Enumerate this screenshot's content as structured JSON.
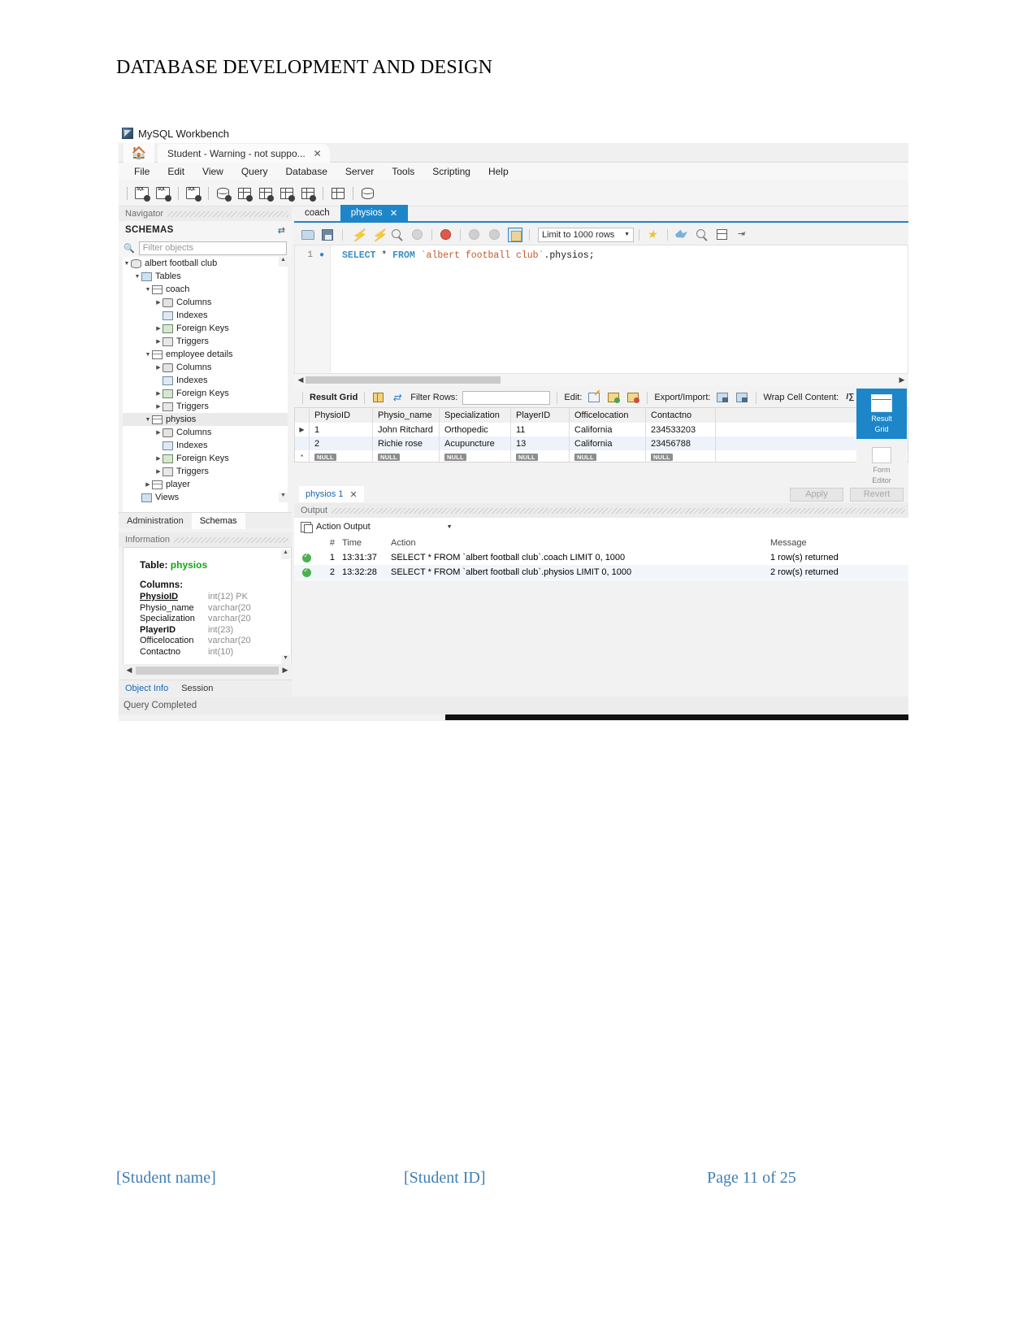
{
  "document": {
    "title": "DATABASE DEVELOPMENT AND DESIGN",
    "footer": {
      "student_name": "[Student name]",
      "student_id": "[Student ID]",
      "page": "Page 11 of 25"
    }
  },
  "app": {
    "title": "MySQL Workbench",
    "icon": "mysql-workbench-icon"
  },
  "tabstrip": {
    "home_icon": "home-icon",
    "doc_tab_label": "Student - Warning - not suppo...",
    "close_icon": "close-icon"
  },
  "menubar": {
    "items": [
      {
        "label": "File"
      },
      {
        "label": "Edit"
      },
      {
        "label": "View"
      },
      {
        "label": "Query"
      },
      {
        "label": "Database"
      },
      {
        "label": "Server"
      },
      {
        "label": "Tools"
      },
      {
        "label": "Scripting"
      },
      {
        "label": "Help"
      }
    ]
  },
  "main_toolbar": {
    "icons": [
      "new-sql-tab-icon",
      "open-sql-script-icon",
      "connect-to-database-icon",
      "new-schema-icon",
      "new-table-icon",
      "new-view-icon",
      "new-procedure-icon",
      "new-function-icon",
      "search-data-icon",
      "reconnect-dbms-icon"
    ]
  },
  "navigator": {
    "panel_label": "Navigator",
    "section_label": "SCHEMAS",
    "refresh_icon": "refresh-icon",
    "search_icon": "search-icon",
    "filter": {
      "placeholder": "Filter objects",
      "value": ""
    },
    "tree": [
      {
        "label": "albert football club",
        "depth": 0,
        "arrow": "down",
        "icon": "database-icon",
        "selected": false
      },
      {
        "label": "Tables",
        "depth": 1,
        "arrow": "down",
        "icon": "folder-icon",
        "selected": false
      },
      {
        "label": "coach",
        "depth": 2,
        "arrow": "down",
        "icon": "table-icon",
        "selected": false
      },
      {
        "label": "Columns",
        "depth": 3,
        "arrow": "right",
        "icon": "columns-icon",
        "selected": false
      },
      {
        "label": "Indexes",
        "depth": 3,
        "arrow": "none",
        "icon": "indexes-icon",
        "selected": false
      },
      {
        "label": "Foreign Keys",
        "depth": 3,
        "arrow": "right",
        "icon": "foreign-keys-icon",
        "selected": false
      },
      {
        "label": "Triggers",
        "depth": 3,
        "arrow": "right",
        "icon": "triggers-icon",
        "selected": false
      },
      {
        "label": "employee details",
        "depth": 2,
        "arrow": "down",
        "icon": "table-icon",
        "selected": false
      },
      {
        "label": "Columns",
        "depth": 3,
        "arrow": "right",
        "icon": "columns-icon",
        "selected": false
      },
      {
        "label": "Indexes",
        "depth": 3,
        "arrow": "none",
        "icon": "indexes-icon",
        "selected": false
      },
      {
        "label": "Foreign Keys",
        "depth": 3,
        "arrow": "right",
        "icon": "foreign-keys-icon",
        "selected": false
      },
      {
        "label": "Triggers",
        "depth": 3,
        "arrow": "right",
        "icon": "triggers-icon",
        "selected": false
      },
      {
        "label": "physios",
        "depth": 2,
        "arrow": "down",
        "icon": "table-icon",
        "selected": true
      },
      {
        "label": "Columns",
        "depth": 3,
        "arrow": "right",
        "icon": "columns-icon",
        "selected": false
      },
      {
        "label": "Indexes",
        "depth": 3,
        "arrow": "none",
        "icon": "indexes-icon",
        "selected": false
      },
      {
        "label": "Foreign Keys",
        "depth": 3,
        "arrow": "right",
        "icon": "foreign-keys-icon",
        "selected": false
      },
      {
        "label": "Triggers",
        "depth": 3,
        "arrow": "right",
        "icon": "triggers-icon",
        "selected": false
      },
      {
        "label": "player",
        "depth": 2,
        "arrow": "right",
        "icon": "table-icon",
        "selected": false
      },
      {
        "label": "Views",
        "depth": 1,
        "arrow": "none",
        "icon": "folder-icon",
        "selected": false
      }
    ],
    "bottom_tabs": [
      {
        "label": "Administration",
        "active": false
      },
      {
        "label": "Schemas",
        "active": true
      }
    ]
  },
  "information": {
    "panel_label": "Information",
    "table_label": "Table:",
    "table_name": "physios",
    "columns_label": "Columns:",
    "columns": [
      {
        "name": "PhysioID",
        "type": "int(12) PK",
        "style": "pk"
      },
      {
        "name": "Physio_name",
        "type": "varchar(20",
        "style": "normal"
      },
      {
        "name": "Specialization",
        "type": "varchar(20",
        "style": "normal"
      },
      {
        "name": "PlayerID",
        "type": "int(23)",
        "style": "bold"
      },
      {
        "name": "Officelocation",
        "type": "varchar(20",
        "style": "normal"
      },
      {
        "name": "Contactno",
        "type": "int(10)",
        "style": "normal"
      }
    ],
    "bottom_tabs": [
      {
        "label": "Object Info",
        "active": true
      },
      {
        "label": "Session",
        "active": false
      }
    ]
  },
  "editor": {
    "tabs": [
      {
        "label": "coach",
        "active": false,
        "closable": false
      },
      {
        "label": "physios",
        "active": true,
        "closable": true
      }
    ],
    "toolbar": {
      "icons": [
        "open-script-icon",
        "save-script-icon",
        "execute-icon",
        "execute-current-statement-icon",
        "explain-icon",
        "stop-icon",
        "toggle-breakpoint-icon",
        "commit-icon",
        "rollback-icon",
        "auto-commit-icon",
        "beautify-icon",
        "find-icon",
        "toggle-invisible-chars-icon",
        "wrap-lines-icon"
      ],
      "limit_label": "Limit to 1000 rows",
      "caret_icon": "chevron-down-icon"
    },
    "line_number": "1",
    "sql": {
      "kw1": "SELECT",
      "star": "*",
      "kw2": "FROM",
      "table_ref": "`albert football club`",
      "suffix": ".physios;"
    }
  },
  "results": {
    "toolbar": {
      "result_grid_label": "Result Grid",
      "grid_icon": "grid-view-icon",
      "refresh_icon": "refresh-icon",
      "filter_rows_label": "Filter Rows:",
      "filter_rows_value": "",
      "edit_label": "Edit:",
      "edit_icons": [
        "edit-row-icon",
        "insert-row-icon",
        "delete-row-icon"
      ],
      "export_import_label": "Export/Import:",
      "export_icons": [
        "export-recordset-icon",
        "import-recordset-icon"
      ],
      "wrap_cell_label": "Wrap Cell Content:",
      "wrap_cell_icon": "wrap-text-icon"
    },
    "columns": [
      "PhysioID",
      "Physio_name",
      "Specialization",
      "PlayerID",
      "Officelocation",
      "Contactno"
    ],
    "rows": [
      {
        "marker": "▶",
        "cells": [
          "1",
          "John Ritchard",
          "Orthopedic",
          "11",
          "California",
          "234533203"
        ],
        "null_row": false
      },
      {
        "marker": "",
        "cells": [
          "2",
          "Richie rose",
          "Acupuncture",
          "13",
          "California",
          "23456788"
        ],
        "null_row": false
      },
      {
        "marker": "*",
        "cells": [
          "NULL",
          "NULL",
          "NULL",
          "NULL",
          "NULL",
          "NULL"
        ],
        "null_row": true
      }
    ],
    "side_buttons": [
      {
        "label_line1": "Result",
        "label_line2": "Grid",
        "active": true,
        "icon": "result-grid-icon"
      },
      {
        "label_line1": "Form",
        "label_line2": "Editor",
        "active": false,
        "icon": "form-editor-icon"
      }
    ],
    "result_tab": "physios 1",
    "apply_label": "Apply",
    "revert_label": "Revert"
  },
  "output": {
    "panel_label": "Output",
    "selector_label": "Action Output",
    "selector_icon": "action-output-icon",
    "caret_icon": "chevron-down-icon",
    "columns": [
      "#",
      "Time",
      "Action",
      "Message"
    ],
    "rows": [
      {
        "status": "success",
        "num": "1",
        "time": "13:31:37",
        "action": "SELECT * FROM `albert football club`.coach LIMIT 0, 1000",
        "message": "1 row(s) returned"
      },
      {
        "status": "success",
        "num": "2",
        "time": "13:32:28",
        "action": "SELECT * FROM `albert football club`.physios LIMIT 0, 1000",
        "message": "2 row(s) returned"
      }
    ]
  },
  "status_bar": {
    "text": "Query Completed"
  },
  "colors": {
    "accent": "#1d86c8",
    "link": "#1667b5",
    "success": "#4caf50",
    "keyword": "#3b8cc4",
    "string": "#c05a2e",
    "table_name": "#16a416"
  }
}
